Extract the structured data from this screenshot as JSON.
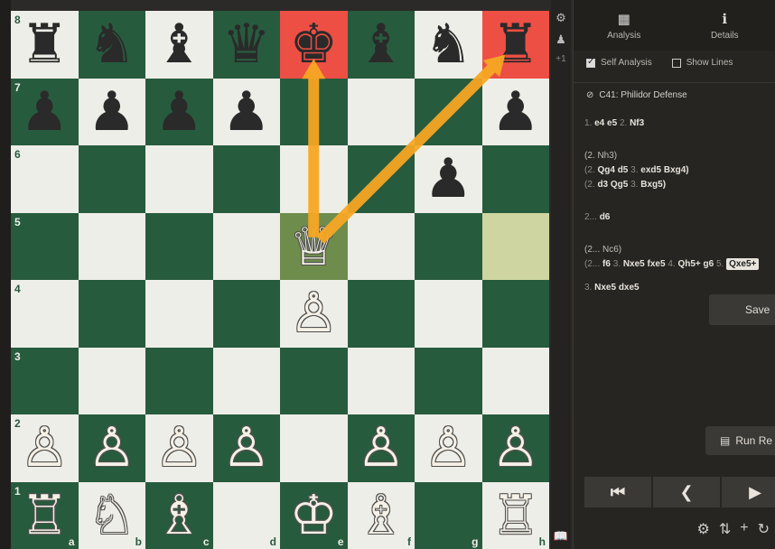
{
  "board": {
    "ranks": [
      "8",
      "7",
      "6",
      "5",
      "4",
      "3",
      "2",
      "1"
    ],
    "files": [
      "a",
      "b",
      "c",
      "d",
      "e",
      "f",
      "g",
      "h"
    ],
    "pieces": [
      {
        "sq": "a8",
        "glyph": "♜",
        "color": "b",
        "name": "black-rook-icon"
      },
      {
        "sq": "b8",
        "glyph": "♞",
        "color": "b",
        "name": "black-knight-icon"
      },
      {
        "sq": "c8",
        "glyph": "♝",
        "color": "b",
        "name": "black-bishop-icon"
      },
      {
        "sq": "d8",
        "glyph": "♛",
        "color": "b",
        "name": "black-queen-icon"
      },
      {
        "sq": "e8",
        "glyph": "♚",
        "color": "b",
        "name": "black-king-icon"
      },
      {
        "sq": "f8",
        "glyph": "♝",
        "color": "b",
        "name": "black-bishop-icon"
      },
      {
        "sq": "g8",
        "glyph": "♞",
        "color": "b",
        "name": "black-knight-icon"
      },
      {
        "sq": "h8",
        "glyph": "♜",
        "color": "b",
        "name": "black-rook-icon"
      },
      {
        "sq": "a7",
        "glyph": "♟",
        "color": "b",
        "name": "black-pawn-icon"
      },
      {
        "sq": "b7",
        "glyph": "♟",
        "color": "b",
        "name": "black-pawn-icon"
      },
      {
        "sq": "c7",
        "glyph": "♟",
        "color": "b",
        "name": "black-pawn-icon"
      },
      {
        "sq": "d7",
        "glyph": "♟",
        "color": "b",
        "name": "black-pawn-icon"
      },
      {
        "sq": "h7",
        "glyph": "♟",
        "color": "b",
        "name": "black-pawn-icon"
      },
      {
        "sq": "g6",
        "glyph": "♟",
        "color": "b",
        "name": "black-pawn-icon"
      },
      {
        "sq": "e5",
        "glyph": "♕",
        "color": "w",
        "name": "white-queen-icon"
      },
      {
        "sq": "e4",
        "glyph": "♙",
        "color": "w",
        "name": "white-pawn-icon"
      },
      {
        "sq": "a2",
        "glyph": "♙",
        "color": "w",
        "name": "white-pawn-icon"
      },
      {
        "sq": "b2",
        "glyph": "♙",
        "color": "w",
        "name": "white-pawn-icon"
      },
      {
        "sq": "c2",
        "glyph": "♙",
        "color": "w",
        "name": "white-pawn-icon"
      },
      {
        "sq": "d2",
        "glyph": "♙",
        "color": "w",
        "name": "white-pawn-icon"
      },
      {
        "sq": "f2",
        "glyph": "♙",
        "color": "w",
        "name": "white-pawn-icon"
      },
      {
        "sq": "g2",
        "glyph": "♙",
        "color": "w",
        "name": "white-pawn-icon"
      },
      {
        "sq": "h2",
        "glyph": "♙",
        "color": "w",
        "name": "white-pawn-icon"
      },
      {
        "sq": "a1",
        "glyph": "♖",
        "color": "w",
        "name": "white-rook-icon"
      },
      {
        "sq": "b1",
        "glyph": "♘",
        "color": "w",
        "name": "white-knight-icon"
      },
      {
        "sq": "c1",
        "glyph": "♗",
        "color": "w",
        "name": "white-bishop-icon"
      },
      {
        "sq": "e1",
        "glyph": "♔",
        "color": "w",
        "name": "white-king-icon"
      },
      {
        "sq": "f1",
        "glyph": "♗",
        "color": "w",
        "name": "white-bishop-icon"
      },
      {
        "sq": "h1",
        "glyph": "♖",
        "color": "w",
        "name": "white-rook-icon"
      }
    ],
    "red_squares": [
      "e8",
      "h8"
    ],
    "highlight_squares": [
      "e5",
      "h5"
    ],
    "arrows": [
      {
        "from": "e5",
        "to": "e8",
        "color": "#f5a623"
      },
      {
        "from": "e5",
        "to": "h8",
        "color": "#f5a623"
      }
    ],
    "colors": {
      "light": "#eeeee8",
      "dark": "#275b3e",
      "check": "#ee4f44",
      "arrow": "#f5a623"
    }
  },
  "tool_col": {
    "gear": "⚙",
    "pawn": "♟",
    "counter": "+1",
    "book": "📖"
  },
  "panel": {
    "tabs": [
      {
        "label": "Analysis",
        "icon": "▦",
        "icon_name": "analysis-icon"
      },
      {
        "label": "Details",
        "icon": "ℹ",
        "icon_name": "info-icon"
      }
    ],
    "options": [
      {
        "label": "Self Analysis",
        "checked": true
      },
      {
        "label": "Show Lines",
        "checked": false
      }
    ],
    "opening": {
      "icon": "⊘",
      "text": "C41: Philidor Defense"
    },
    "moves": [
      {
        "num1": "1.",
        "m1": "e4",
        "m2": "e5",
        "num2": "2.",
        "m3": "Nf3"
      },
      {
        "text": "(2. Nh3)"
      },
      {
        "a": "(2.",
        "b": "Qg4",
        "c": "d5",
        "d": "3.",
        "e": "exd5",
        "f": "Bxg4)"
      },
      {
        "a": "(2.",
        "b": "d3",
        "c": "Qg5",
        "d": "3.",
        "e": "Bxg5)"
      },
      {
        "a": "2...",
        "b": "d6"
      },
      {
        "text": "(2... Nc6)"
      },
      {
        "a": "(2...",
        "b": "f6",
        "c": "3.",
        "d": "Nxe5",
        "e": "fxe5",
        "f": "4.",
        "g": "Qh5+",
        "h": "g6",
        "i": "5.",
        "j": "Qxe5+"
      },
      {
        "a": "3.",
        "b": "Nxe5",
        "c": "dxe5"
      }
    ],
    "save_label": "Save",
    "run_label": "Run Re",
    "nav": [
      "⏮",
      "❮",
      "▶"
    ],
    "bottom_tools": [
      "⚙",
      "⇅",
      "+",
      "↻"
    ]
  }
}
